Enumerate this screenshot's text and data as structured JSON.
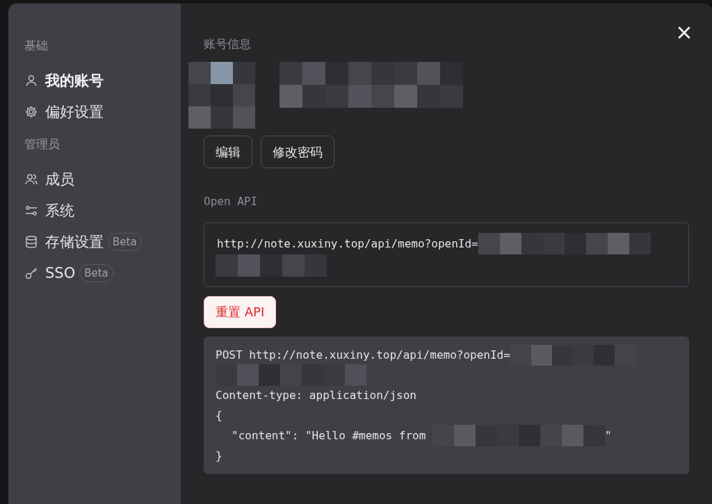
{
  "sidebar": {
    "sections": [
      {
        "title": "基础",
        "items": [
          {
            "label": "我的账号",
            "selected": true
          },
          {
            "label": "偏好设置",
            "selected": false
          }
        ]
      },
      {
        "title": "管理员",
        "items": [
          {
            "label": "成员",
            "selected": false
          },
          {
            "label": "系统",
            "selected": false
          },
          {
            "label": "存储设置",
            "selected": false,
            "badge": "Beta"
          },
          {
            "label": "SSO",
            "selected": false,
            "badge": "Beta"
          }
        ]
      }
    ]
  },
  "account": {
    "title": "账号信息",
    "buttons": [
      "编辑",
      "修改密码"
    ]
  },
  "open_api": {
    "title": "Open API",
    "url": "http://note.xuxiny.top/api/memo?openId=",
    "reset_button": "重置 API",
    "example": {
      "request_line": "POST http://note.xuxiny.top/api/memo?openId=",
      "header": "Content-type: application/json",
      "open_brace": "{",
      "body_prefix": "\"content\": \"Hello #memos from ",
      "body_suffix": "\"",
      "close_brace": "}"
    }
  }
}
